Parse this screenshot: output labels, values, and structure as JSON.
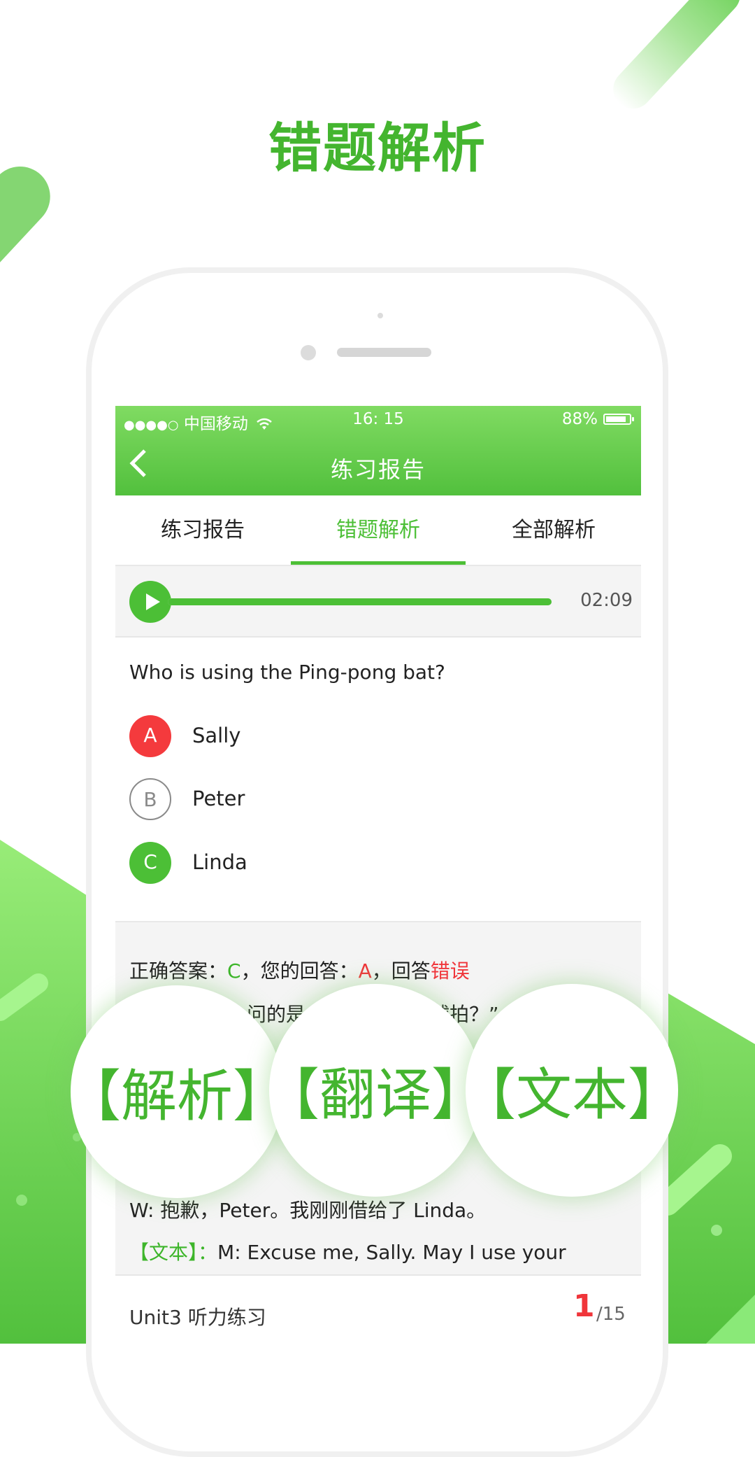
{
  "promo": {
    "title": "错题解析"
  },
  "status_bar": {
    "signal": "●●●●○",
    "carrier": "中国移动",
    "wifi_icon": "wifi-icon",
    "time": "16: 15",
    "battery_percent": "88%",
    "battery_level": 0.88
  },
  "nav": {
    "back_icon": "chevron-left-icon",
    "title": "练习报告"
  },
  "tabs": [
    {
      "label": "练习报告",
      "active": false
    },
    {
      "label": "错题解析",
      "active": true
    },
    {
      "label": "全部解析",
      "active": false
    }
  ],
  "player": {
    "play_icon": "play-icon",
    "progress": 1.0,
    "duration": "02:09"
  },
  "question": {
    "text": "Who is using the Ping-pong bat?",
    "options": [
      {
        "letter": "A",
        "text": "Sally",
        "state": "wrong"
      },
      {
        "letter": "B",
        "text": "Peter",
        "state": "neutral"
      },
      {
        "letter": "C",
        "text": "Linda",
        "state": "correct"
      }
    ]
  },
  "analysis": {
    "correct_label": "正确答案：",
    "correct_value": "C",
    "sep1": "，您的回答：",
    "your_value": "A",
    "sep2": "，回答",
    "result": "错误",
    "fragment_1a": "问的是",
    "fragment_1b": "球拍？”",
    "translation_line": "W: 抱歉，Peter。我刚刚借给了 Linda。",
    "text_tag": "【文本】",
    "text_colon": "：",
    "text_line": "M: Excuse me, Sally. May I use your"
  },
  "footer": {
    "unit": "Unit3  听力练习",
    "page_current": "1",
    "page_total": "/15"
  },
  "bubbles": [
    {
      "label": "【解析】"
    },
    {
      "label": "【翻译】"
    },
    {
      "label": "【文本】"
    }
  ],
  "colors": {
    "brand_green": "#4cbf36",
    "error_red": "#f0353a"
  }
}
